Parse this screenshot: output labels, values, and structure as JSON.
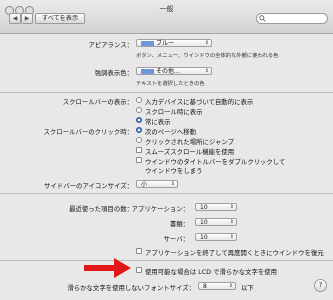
{
  "window": {
    "title": "一般"
  },
  "toolbar": {
    "show_all_label": "すべてを表示",
    "back": "◀",
    "forward": "▶",
    "search_placeholder": ""
  },
  "appearance": {
    "label": "アピアランス：",
    "value": "ブルー",
    "swatch_color": "#6f96d8",
    "description": "ボタン、メニュー、ウインドウの全体的な外観に使われる色"
  },
  "highlight": {
    "label": "強調表示色：",
    "value": "その他...",
    "swatch_color": "#6f96d8",
    "description": "テキストを選択したときの色"
  },
  "scrollbars": {
    "show_label": "スクロールバーの表示：",
    "show_options": [
      {
        "label": "入力デバイスに基づいて自動的に表示",
        "selected": false
      },
      {
        "label": "スクロール時に表示",
        "selected": false
      },
      {
        "label": "常に表示",
        "selected": true
      }
    ],
    "click_label": "スクロールバーのクリック時：",
    "click_options": [
      {
        "label": "次のページへ移動",
        "selected": true
      },
      {
        "label": "クリックされた場所にジャンプ",
        "selected": false
      }
    ],
    "smooth_scrolling": {
      "label": "スムーズスクロール機能を使用",
      "checked": false
    },
    "double_click": {
      "label_line1": "ウインドウのタイトルバーをダブルクリックして",
      "label_line2": "ウインドウをしまう",
      "checked": false
    }
  },
  "sidebar_icon": {
    "label": "サイドバーのアイコンサイズ：",
    "value": "小"
  },
  "recent": {
    "label": "最近使った項目の数：",
    "rows": [
      {
        "label": "アプリケーション：",
        "value": "10"
      },
      {
        "label": "書類：",
        "value": "10"
      },
      {
        "label": "サーバ：",
        "value": "10"
      }
    ],
    "restore_windows": {
      "label": "アプリケーションを終了して再度開くときにウインドウを復元",
      "checked": false
    }
  },
  "lcd_smoothing": {
    "label": "使用可能な場合は LCD で滑らかな文字を使用",
    "checked": false
  },
  "font_smoothing": {
    "label": "滑らかな文字を使用しないフォントサイズ：",
    "value": "8",
    "suffix": "以下"
  },
  "annotation": {
    "arrow_color": "#e01818"
  },
  "help": {
    "label": "?"
  }
}
